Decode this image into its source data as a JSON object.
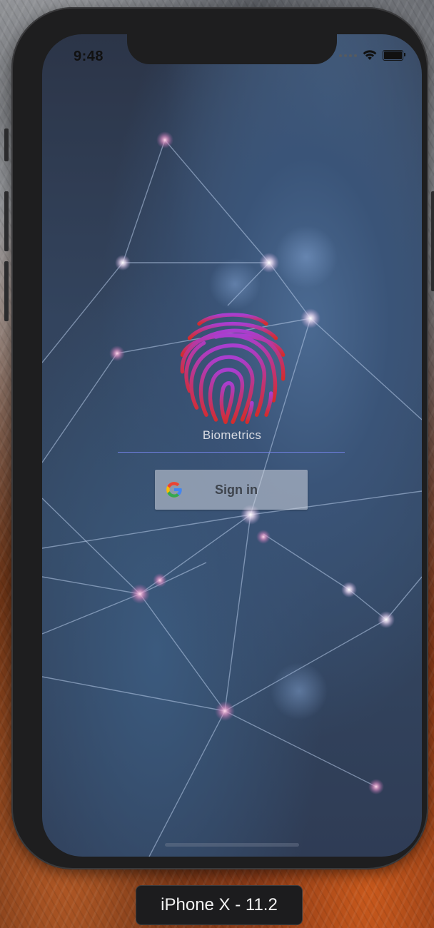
{
  "status_bar": {
    "time": "9:48"
  },
  "app": {
    "biometrics_label": "Biometrics",
    "signin_label": "Sign in"
  },
  "simulator": {
    "device_label": "iPhone X - 11.2"
  },
  "icons": {
    "fingerprint": "fingerprint-icon",
    "google": "google-g-icon",
    "wifi": "wifi-icon",
    "battery": "battery-icon"
  },
  "colors": {
    "fingerprint_top": "#b23cc4",
    "fingerprint_bottom": "#d02d2d",
    "divider": "#6f7fe0",
    "google_blue": "#4285F4",
    "google_red": "#EA4335",
    "google_yellow": "#FBBC05",
    "google_green": "#34A853"
  }
}
